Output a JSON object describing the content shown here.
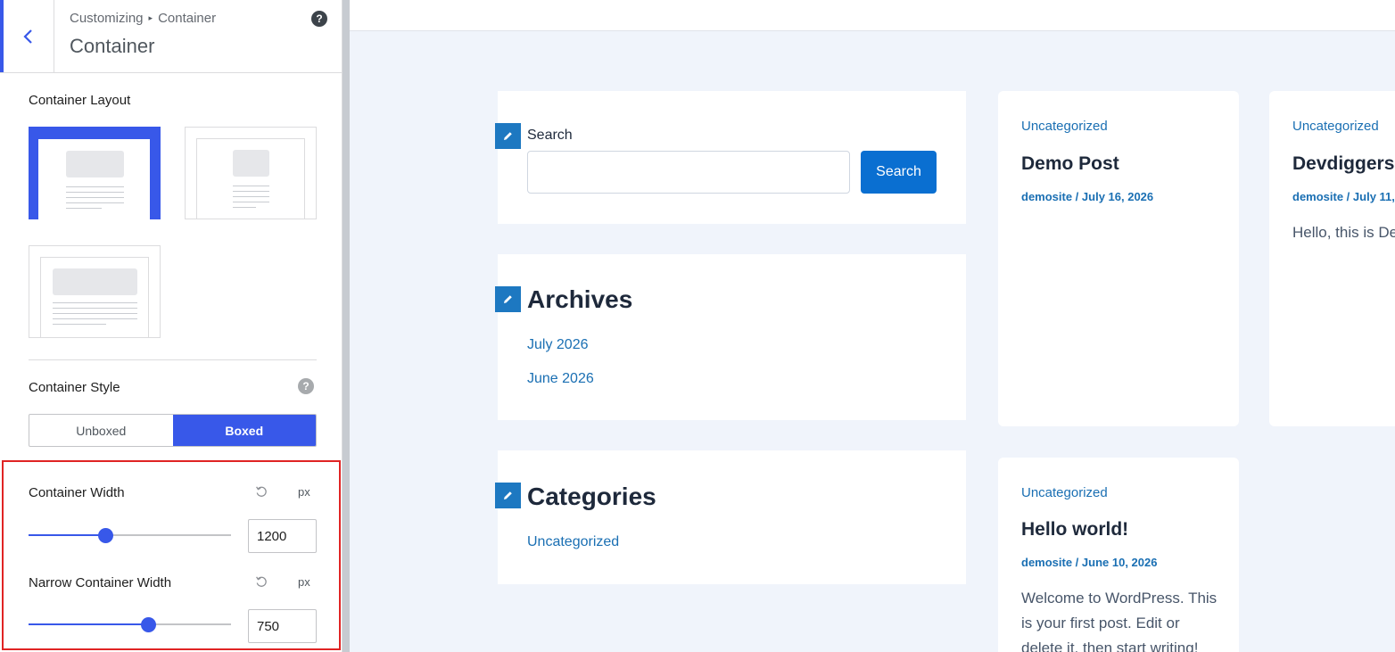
{
  "sidebar": {
    "breadcrumb_root": "Customizing",
    "breadcrumb_current": "Container",
    "title": "Container",
    "layout_label": "Container Layout",
    "style_label": "Container Style",
    "style_options": [
      "Unboxed",
      "Boxed"
    ],
    "style_selected": "Boxed",
    "container_width": {
      "label": "Container Width",
      "unit": "px",
      "value": "1200",
      "slider_fraction": 0.38
    },
    "narrow_width": {
      "label": "Narrow Container Width",
      "unit": "px",
      "value": "750",
      "slider_fraction": 0.59
    }
  },
  "preview": {
    "search_widget": {
      "label": "Search",
      "button": "Search",
      "placeholder": ""
    },
    "archives_widget": {
      "title": "Archives",
      "links": [
        "July 2026",
        "June 2026"
      ]
    },
    "categories_widget": {
      "title": "Categories",
      "links": [
        "Uncategorized"
      ]
    },
    "posts": [
      {
        "category": "Uncategorized",
        "title": "Demo Post",
        "meta": "demosite / July 16, 2026",
        "excerpt": ""
      },
      {
        "category": "Uncategorized",
        "title": "Devdiggers",
        "meta": "demosite / July 11,",
        "excerpt": "Hello, this is Dev"
      },
      {
        "category": "Uncategorized",
        "title": "Hello world!",
        "meta": "demosite / June 10, 2026",
        "excerpt": "Welcome to WordPress. This is your first post. Edit or delete it, then start writing!"
      }
    ]
  },
  "colors": {
    "accent": "#3858e9",
    "link": "#1a6fb3",
    "highlight_box": "#e02424"
  }
}
